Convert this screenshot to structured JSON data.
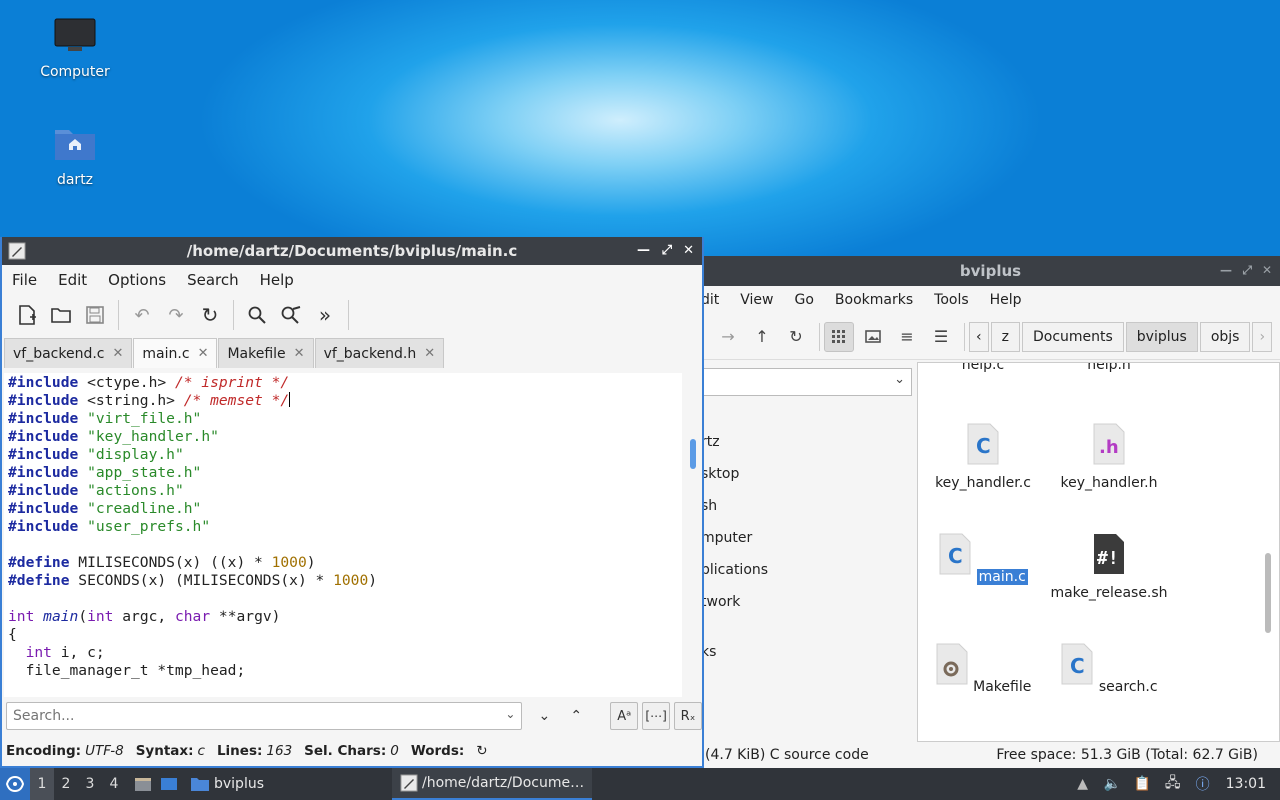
{
  "desktop": {
    "icons": [
      {
        "label": "Computer",
        "icon": "computer-icon"
      },
      {
        "label": "dartz",
        "icon": "home-folder-icon"
      }
    ]
  },
  "file_manager": {
    "title": "bviplus",
    "menu": [
      "dit",
      "View",
      "Go",
      "Bookmarks",
      "Tools",
      "Help"
    ],
    "breadcrumbs": [
      "z",
      "Documents",
      "bviplus",
      "objs"
    ],
    "current_crumb": "bviplus",
    "sidebar": [
      "rtz",
      "sktop",
      "sh",
      "mputer",
      "plications",
      "twork",
      "ks"
    ],
    "files": [
      {
        "name": "help.c",
        "icon": "c-source-icon"
      },
      {
        "name": "help.h",
        "icon": "h-header-icon"
      },
      {
        "name": "key_handler.c",
        "icon": "c-source-icon"
      },
      {
        "name": "key_handler.h",
        "icon": "h-header-icon"
      },
      {
        "name": "main.c",
        "icon": "c-source-icon"
      },
      {
        "name": "make_release.sh",
        "icon": "shell-script-icon"
      },
      {
        "name": "Makefile",
        "icon": "makefile-icon"
      },
      {
        "name": "search.c",
        "icon": "c-source-icon"
      }
    ],
    "status_left": "(4.7 KiB) C source code",
    "status_right": "Free space: 51.3 GiB (Total: 62.7 GiB)"
  },
  "editor": {
    "title": "/home/dartz/Documents/bviplus/main.c",
    "menu": [
      "File",
      "Edit",
      "Options",
      "Search",
      "Help"
    ],
    "tabs": [
      "vf_backend.c",
      "main.c",
      "Makefile",
      "vf_backend.h"
    ],
    "active_tab": "main.c",
    "search_placeholder": "Search...",
    "status": {
      "encoding_label": "Encoding:",
      "encoding": "UTF-8",
      "syntax_label": "Syntax:",
      "syntax": "c",
      "lines_label": "Lines:",
      "lines": "163",
      "sel_label": "Sel. Chars:",
      "sel": "0",
      "words_label": "Words:"
    },
    "code_lines": [
      "#include <ctype.h> /* isprint */",
      "#include <string.h> /* memset */",
      "#include \"virt_file.h\"",
      "#include \"key_handler.h\"",
      "#include \"display.h\"",
      "#include \"app_state.h\"",
      "#include \"actions.h\"",
      "#include \"creadline.h\"",
      "#include \"user_prefs.h\"",
      "",
      "#define MILISECONDS(x) ((x) * 1000)",
      "#define SECONDS(x) (MILISECONDS(x) * 1000)",
      "",
      "int main(int argc, char **argv)",
      "{",
      "  int i, c;",
      "  file_manager_t *tmp_head;"
    ]
  },
  "taskbar": {
    "workspaces": [
      "1",
      "2",
      "3",
      "4"
    ],
    "current_workspace": "1",
    "tasks": [
      {
        "label": "bviplus",
        "icon": "folder-icon"
      },
      {
        "label": "/home/dartz/Docume…",
        "icon": "text-editor-icon"
      }
    ],
    "clock": "13:01"
  }
}
